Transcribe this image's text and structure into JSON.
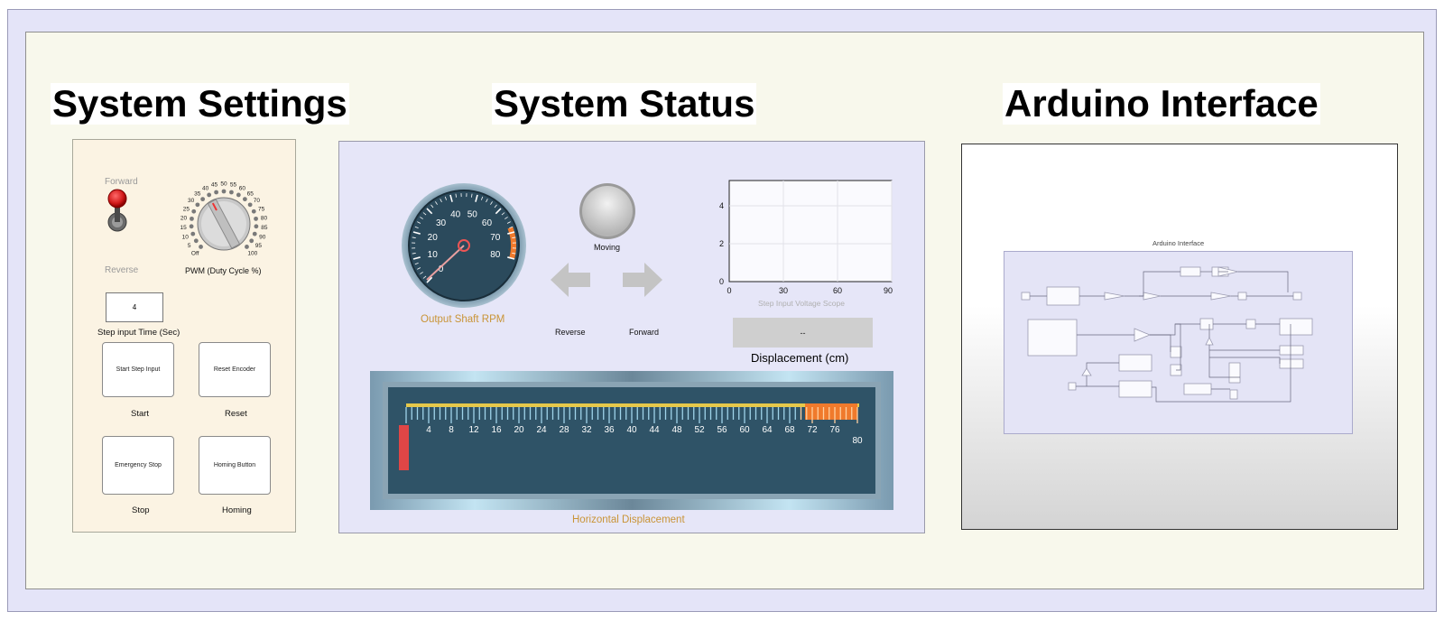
{
  "titles": {
    "settings": "System Settings",
    "status": "System Status",
    "arduino": "Arduino Interface"
  },
  "settings": {
    "toggle_top_label": "Forward",
    "toggle_bottom_label": "Reverse",
    "knob_label": "PWM (Duty Cycle %)",
    "knob_ticks": [
      "Off",
      "5",
      "10",
      "15",
      "20",
      "25",
      "30",
      "35",
      "40",
      "45",
      "50",
      "55",
      "60",
      "65",
      "70",
      "75",
      "80",
      "85",
      "90",
      "95",
      "100"
    ],
    "step_time_value": "4",
    "step_time_label": "Step input Time (Sec)",
    "buttons": [
      {
        "text": "Start Step Input",
        "caption": "Start"
      },
      {
        "text": "Reset Encoder",
        "caption": "Reset"
      },
      {
        "text": "Emergency Stop",
        "caption": "Stop"
      },
      {
        "text": "Homing Button",
        "caption": "Homing"
      }
    ]
  },
  "status": {
    "gauge_label": "Output Shaft RPM",
    "gauge_ticks": [
      "0",
      "10",
      "20",
      "30",
      "40",
      "50",
      "60",
      "70",
      "80"
    ],
    "lamp_label": "Moving",
    "arrow_reverse_label": "Reverse",
    "arrow_forward_label": "Forward",
    "scope_title": "Step Input Voltage Scope",
    "scope_x_ticks": [
      "0",
      "30",
      "60",
      "90"
    ],
    "scope_y_ticks": [
      "0",
      "2",
      "4"
    ],
    "display_value": "--",
    "display_label": "Displacement (cm)",
    "linear_label": "Horizontal Displacement",
    "linear_ticks": [
      "4",
      "8",
      "12",
      "16",
      "20",
      "24",
      "28",
      "32",
      "36",
      "40",
      "44",
      "48",
      "52",
      "56",
      "60",
      "64",
      "68",
      "72",
      "76",
      "80"
    ]
  },
  "arduino": {
    "diagram_title": "Arduino Interface"
  },
  "colors": {
    "gauge_face": "#2b4a5c",
    "linear_face": "#2f5367",
    "warning": "#f07a2c",
    "label_gold": "#c99437"
  }
}
